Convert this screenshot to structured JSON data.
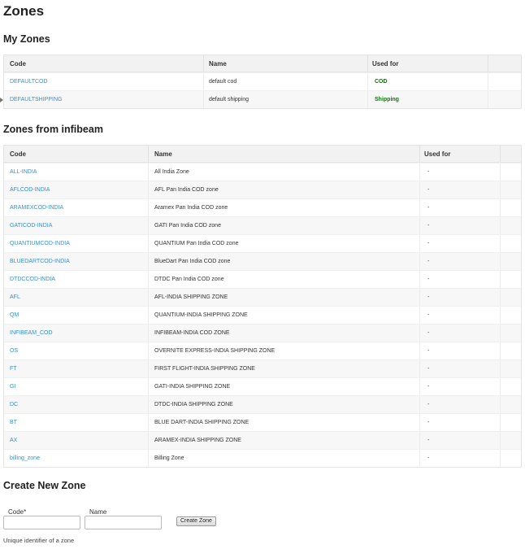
{
  "page_title": "Zones",
  "my_zones": {
    "title": "My Zones",
    "headers": {
      "code": "Code",
      "name": "Name",
      "used_for": "Used for"
    },
    "rows": [
      {
        "code": "DEFAULTCOD",
        "name": "default cod",
        "used_for": "COD"
      },
      {
        "code": "DEFAULTSHIPPING",
        "name": "default shipping",
        "used_for": "Shipping"
      }
    ]
  },
  "infibeam_zones": {
    "title": "Zones from infibeam",
    "headers": {
      "code": "Code",
      "name": "Name",
      "used_for": "Used for"
    },
    "rows": [
      {
        "code": "ALL-INDIA",
        "name": "All India Zone",
        "used_for": "-"
      },
      {
        "code": "AFLCOD-INDIA",
        "name": "AFL Pan India COD zone",
        "used_for": "-"
      },
      {
        "code": "ARAMEXCOD-INDIA",
        "name": "Aramex Pan India COD zone",
        "used_for": "-"
      },
      {
        "code": "GATICOD-INDIA",
        "name": "GATI Pan India COD zone",
        "used_for": "-"
      },
      {
        "code": "QUANTIUMCOD-INDIA",
        "name": "QUANTIUM Pan India COD zone",
        "used_for": "-"
      },
      {
        "code": "BLUEDARTCOD-INDIA",
        "name": "BlueDart Pan India COD zone",
        "used_for": "-"
      },
      {
        "code": "DTDCCOD-INDIA",
        "name": "DTDC Pan India COD zone",
        "used_for": "-"
      },
      {
        "code": "AFL",
        "name": "AFL-INDIA SHIPPING ZONE",
        "used_for": "-"
      },
      {
        "code": "QM",
        "name": "QUANTIUM-INDIA SHIPPING ZONE",
        "used_for": "-"
      },
      {
        "code": "INFIBEAM_COD",
        "name": "INFIBEAM-INDIA COD ZONE",
        "used_for": "-"
      },
      {
        "code": "OS",
        "name": "OVERNITE EXPRESS-INDIA SHIPPING ZONE",
        "used_for": "-"
      },
      {
        "code": "FT",
        "name": "FIRST FLIGHT-INDIA SHIPPING ZONE",
        "used_for": "-"
      },
      {
        "code": "GI",
        "name": "GATI-INDIA SHIPPING ZONE",
        "used_for": "-"
      },
      {
        "code": "DC",
        "name": "DTDC-INDIA SHIPPING ZONE",
        "used_for": "-"
      },
      {
        "code": "BT",
        "name": "BLUE DART-INDIA SHIPPING ZONE",
        "used_for": "-"
      },
      {
        "code": "AX",
        "name": "ARAMEX-INDIA SHIPPING ZONE",
        "used_for": "-"
      },
      {
        "code": "billing_zone",
        "name": "Billing Zone",
        "used_for": "-"
      }
    ]
  },
  "create_zone": {
    "title": "Create New Zone",
    "code_label": "Code*",
    "name_label": "Name",
    "code_value": "",
    "name_value": "",
    "button_label": "Create Zone",
    "hint": "Unique identifier of a zone"
  },
  "colors": {
    "link": "#3d8fc9",
    "used_for_green": "#0a7a0a"
  }
}
